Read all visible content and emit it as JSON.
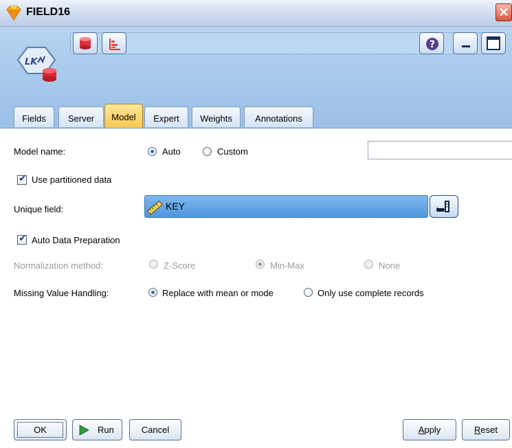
{
  "window": {
    "title": "FIELD16",
    "close_label": "✕"
  },
  "toolbar": {
    "buttons": [
      {
        "name": "preview-data-icon"
      },
      {
        "name": "chart-icon"
      },
      {
        "name": "help-icon",
        "label": "?"
      },
      {
        "name": "minimize-icon"
      },
      {
        "name": "maximize-icon"
      }
    ]
  },
  "tabs": [
    {
      "label": "Fields",
      "active": false
    },
    {
      "label": "Server",
      "active": false
    },
    {
      "label": "Model",
      "active": true
    },
    {
      "label": "Expert",
      "active": false
    },
    {
      "label": "Weights",
      "active": false
    },
    {
      "label": "Annotations",
      "active": false
    }
  ],
  "model": {
    "model_name_label": "Model name:",
    "auto_label": "Auto",
    "custom_label": "Custom",
    "model_name_mode": "Auto",
    "custom_name_value": "",
    "use_partitioned_label": "Use partitioned data",
    "use_partitioned_checked": true,
    "unique_field_label": "Unique field:",
    "unique_field_value": "KEY",
    "auto_prep_label": "Auto Data Preparation",
    "auto_prep_checked": true,
    "normalization_label": "Normalization method:",
    "normalization_options": [
      "Z-Score",
      "Min-Max",
      "None"
    ],
    "normalization_selected": "Min-Max",
    "missing_label": "Missing Value Handling:",
    "missing_options": [
      "Replace with mean or mode",
      "Only use complete records"
    ],
    "missing_selected": "Replace with mean or mode"
  },
  "buttons": {
    "ok": "OK",
    "run": "Run",
    "cancel": "Cancel",
    "apply_first": "A",
    "apply_rest": "pply",
    "reset_first": "R",
    "reset_rest": "eset"
  },
  "colors": {
    "toolbar_bg": "#a6c8eb",
    "active_tab": "#f8c64c",
    "unique_field_bg": "#5a9fe0",
    "close_button": "#d9573c"
  }
}
